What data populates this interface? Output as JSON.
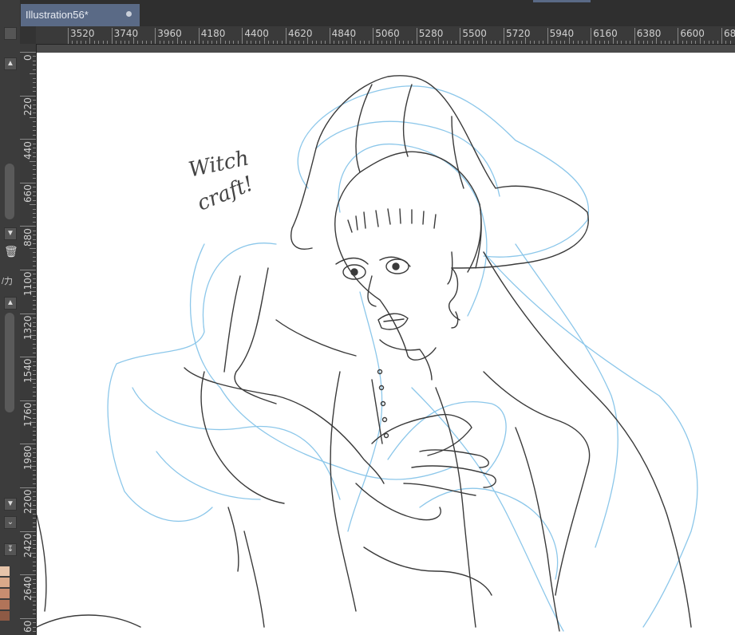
{
  "document": {
    "tab_title": "Illustration56*"
  },
  "ruler": {
    "horizontal": [
      "3520",
      "3740",
      "3960",
      "4180",
      "4400",
      "4620",
      "4840",
      "5060",
      "5280",
      "5500",
      "5720",
      "5940",
      "6160",
      "6380",
      "6600",
      "68"
    ],
    "vertical": [
      "0",
      "220",
      "440",
      "660",
      "880",
      "1100",
      "1320",
      "1540",
      "1760",
      "1980",
      "2200",
      "2420",
      "2640",
      "60"
    ]
  },
  "sketch": {
    "note_line1": "Witch",
    "note_line2": "craft!"
  },
  "left_panel": {
    "label_text": "/力"
  },
  "colors": {
    "tab_active": "#5a6a86",
    "canvas": "#ffffff",
    "sketch_blue": "#8cc7ea",
    "sketch_lines": "#3a3a3a"
  }
}
